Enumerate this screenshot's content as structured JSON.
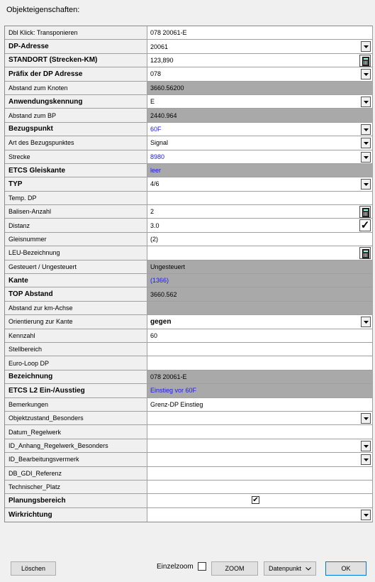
{
  "window": {
    "title": "Objekteigenschaften:"
  },
  "rows": [
    {
      "label": "Dbl Klick: Transponieren",
      "value": "078 20061-E",
      "bold": false,
      "gray": false,
      "blue": false,
      "valbold": false,
      "ctrl": "none"
    },
    {
      "label": "DP-Adresse",
      "value": "20061",
      "bold": true,
      "gray": false,
      "blue": false,
      "valbold": false,
      "ctrl": "dropdown"
    },
    {
      "label": "STANDORT (Strecken-KM)",
      "value": "123,890",
      "bold": true,
      "gray": false,
      "blue": false,
      "valbold": false,
      "ctrl": "calc"
    },
    {
      "label": "Präfix der DP Adresse",
      "value": "078",
      "bold": true,
      "gray": false,
      "blue": false,
      "valbold": false,
      "ctrl": "dropdown"
    },
    {
      "label": "Abstand zum Knoten",
      "value": "3660.56200",
      "bold": false,
      "gray": true,
      "blue": false,
      "valbold": false,
      "ctrl": "none"
    },
    {
      "label": "Anwendungskennung",
      "value": "E",
      "bold": true,
      "gray": false,
      "blue": false,
      "valbold": false,
      "ctrl": "dropdown"
    },
    {
      "label": "Abstand zum BP",
      "value": "2440.964",
      "bold": false,
      "gray": true,
      "blue": false,
      "valbold": false,
      "ctrl": "none"
    },
    {
      "label": "Bezugspunkt",
      "value": "60F",
      "bold": true,
      "gray": false,
      "blue": true,
      "valbold": false,
      "ctrl": "dropdown"
    },
    {
      "label": "Art des Bezugspunktes",
      "value": "Signal",
      "bold": false,
      "gray": false,
      "blue": false,
      "valbold": false,
      "ctrl": "dropdown"
    },
    {
      "label": "Strecke",
      "value": "8980",
      "bold": false,
      "gray": false,
      "blue": true,
      "valbold": false,
      "ctrl": "dropdown"
    },
    {
      "label": "ETCS Gleiskante",
      "value": "leer",
      "bold": true,
      "gray": true,
      "blue": true,
      "valbold": false,
      "ctrl": "none"
    },
    {
      "label": "TYP",
      "value": "4/6",
      "bold": true,
      "gray": false,
      "blue": false,
      "valbold": false,
      "ctrl": "dropdown"
    },
    {
      "label": "Temp. DP",
      "value": "",
      "bold": false,
      "gray": false,
      "blue": false,
      "valbold": false,
      "ctrl": "none"
    },
    {
      "label": "Balisen-Anzahl",
      "value": "2",
      "bold": false,
      "gray": false,
      "blue": false,
      "valbold": false,
      "ctrl": "calc"
    },
    {
      "label": "Distanz",
      "value": "3.0",
      "bold": false,
      "gray": false,
      "blue": false,
      "valbold": false,
      "ctrl": "check"
    },
    {
      "label": "Gleisnummer",
      "value": "(2)",
      "bold": false,
      "gray": false,
      "blue": false,
      "valbold": false,
      "ctrl": "none"
    },
    {
      "label": "LEU-Bezeichnung",
      "value": "",
      "bold": false,
      "gray": false,
      "blue": false,
      "valbold": false,
      "ctrl": "calc"
    },
    {
      "label": "Gesteuert / Ungesteuert",
      "value": "Ungesteuert",
      "bold": false,
      "gray": true,
      "blue": false,
      "valbold": false,
      "ctrl": "none"
    },
    {
      "label": "Kante",
      "value": "(1366)",
      "bold": true,
      "gray": true,
      "blue": true,
      "valbold": false,
      "ctrl": "none"
    },
    {
      "label": "TOP Abstand",
      "value": "3660.562",
      "bold": true,
      "gray": true,
      "blue": false,
      "valbold": false,
      "ctrl": "none"
    },
    {
      "label": "Abstand zur km-Achse",
      "value": "",
      "bold": false,
      "gray": true,
      "blue": false,
      "valbold": false,
      "ctrl": "none"
    },
    {
      "label": "Orientierung zur Kante",
      "value": "gegen",
      "bold": false,
      "gray": false,
      "blue": false,
      "valbold": true,
      "ctrl": "dropdown"
    },
    {
      "label": "Kennzahl",
      "value": "60",
      "bold": false,
      "gray": false,
      "blue": false,
      "valbold": false,
      "ctrl": "none"
    },
    {
      "label": "Stellbereich",
      "value": "",
      "bold": false,
      "gray": false,
      "blue": false,
      "valbold": false,
      "ctrl": "none"
    },
    {
      "label": "Euro-Loop DP",
      "value": "",
      "bold": false,
      "gray": false,
      "blue": false,
      "valbold": false,
      "ctrl": "none"
    },
    {
      "label": "Bezeichnung",
      "value": "078 20061-E",
      "bold": true,
      "gray": true,
      "blue": false,
      "valbold": false,
      "ctrl": "none"
    },
    {
      "label": "ETCS L2 Ein-/Ausstieg",
      "value": "Einstieg vor 60F",
      "bold": true,
      "gray": true,
      "blue": true,
      "valbold": false,
      "ctrl": "none"
    },
    {
      "label": "Bemerkungen",
      "value": "Grenz-DP Einstieg",
      "bold": false,
      "gray": false,
      "blue": false,
      "valbold": false,
      "ctrl": "none"
    },
    {
      "label": "Objektzustand_Besonders",
      "value": "",
      "bold": false,
      "gray": false,
      "blue": false,
      "valbold": false,
      "ctrl": "dropdown"
    },
    {
      "label": "Datum_Regelwerk",
      "value": "",
      "bold": false,
      "gray": false,
      "blue": false,
      "valbold": false,
      "ctrl": "none"
    },
    {
      "label": "ID_Anhang_Regelwerk_Besonders",
      "value": "",
      "bold": false,
      "gray": false,
      "blue": false,
      "valbold": false,
      "ctrl": "dropdown"
    },
    {
      "label": "ID_Bearbeitungsvermerk",
      "value": "",
      "bold": false,
      "gray": false,
      "blue": false,
      "valbold": false,
      "ctrl": "dropdown"
    },
    {
      "label": "DB_GDI_Referenz",
      "value": "",
      "bold": false,
      "gray": false,
      "blue": false,
      "valbold": false,
      "ctrl": "none"
    },
    {
      "label": "Technischer_Platz",
      "value": "",
      "bold": false,
      "gray": false,
      "blue": false,
      "valbold": false,
      "ctrl": "none"
    },
    {
      "label": "Planungsbereich",
      "value": "",
      "bold": true,
      "gray": false,
      "blue": false,
      "valbold": false,
      "ctrl": "checkbox",
      "checked": true
    },
    {
      "label": "Wirkrichtung",
      "value": "",
      "bold": true,
      "gray": false,
      "blue": false,
      "valbold": false,
      "ctrl": "dropdown"
    }
  ],
  "footer": {
    "delete_label": "Löschen",
    "einzelzoom_label": "Einzelzoom",
    "einzelzoom_checked": false,
    "zoom_label": "ZOOM",
    "datenpunkt_label": "Datenpunkt",
    "ok_label": "OK"
  },
  "colors": {
    "gray_cell": "#a9a9a9",
    "blue_text": "#1a1aee",
    "ok_border": "#0078d7"
  }
}
